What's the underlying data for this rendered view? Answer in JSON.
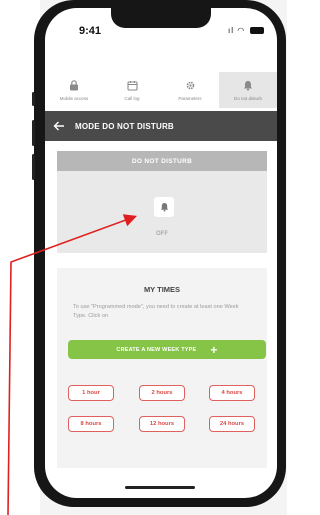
{
  "status_bar": {
    "time": "9:41",
    "signal": "ıl",
    "wifi": "◠"
  },
  "tabs": [
    {
      "label": "Mobile access",
      "icon": "lock-icon",
      "active": false
    },
    {
      "label": "Call log",
      "icon": "calendar-icon",
      "active": false
    },
    {
      "label": "Parameters",
      "icon": "gear-icon",
      "active": false
    },
    {
      "label": "Do not disturb",
      "icon": "bell-icon",
      "active": true
    }
  ],
  "header": {
    "title": "MODE DO NOT DISTURB",
    "back_icon": "arrow-left-icon"
  },
  "dnd": {
    "heading": "DO NOT DISTURB",
    "state": "OFF",
    "icon": "bell-icon"
  },
  "my_times": {
    "title": "MY TIMES",
    "description": "To use \"Programmed mode\", you need to create at least one Week Type. Click on",
    "create_button": "CREATE A NEW WEEK TYPE",
    "durations": [
      "1 hour",
      "2 hours",
      "4 hours",
      "8 hours",
      "12 hours",
      "24 hours"
    ]
  },
  "colors": {
    "accent_green": "#86c447",
    "duration_red": "#e0605e",
    "header_dark": "#4a4a4a",
    "arrow_red": "#e02020"
  }
}
